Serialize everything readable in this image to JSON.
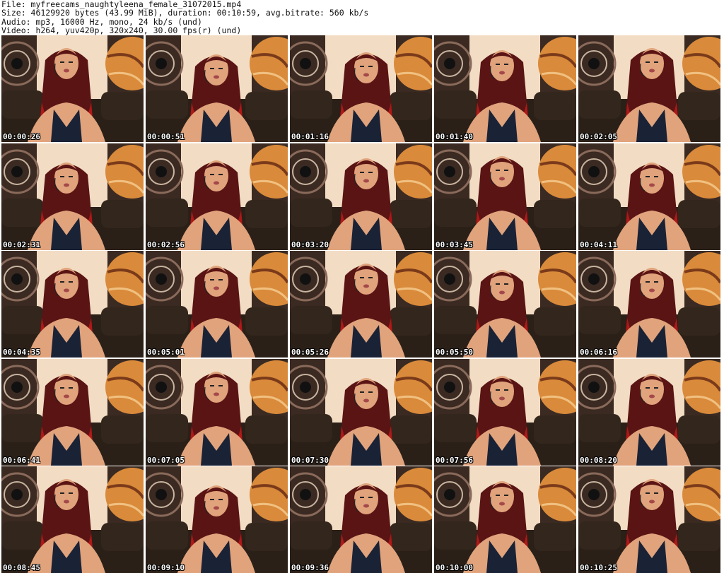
{
  "info": {
    "file": "File: myfreecams_naughtyleena_female_31072015.mp4",
    "size": "Size: 46129920 bytes (43.99 MiB), duration: 00:10:59, avg.bitrate: 560 kb/s",
    "audio": "Audio: mp3, 16000 Hz, mono, 24 kb/s (und)",
    "video": "Video: h264, yuv420p, 320x240, 30.00 fps(r) (und)"
  },
  "thumbnails": [
    {
      "time": "00:00:26"
    },
    {
      "time": "00:00:51"
    },
    {
      "time": "00:01:16"
    },
    {
      "time": "00:01:40"
    },
    {
      "time": "00:02:05"
    },
    {
      "time": "00:02:31"
    },
    {
      "time": "00:02:56"
    },
    {
      "time": "00:03:20"
    },
    {
      "time": "00:03:45"
    },
    {
      "time": "00:04:11"
    },
    {
      "time": "00:04:35"
    },
    {
      "time": "00:05:01"
    },
    {
      "time": "00:05:26"
    },
    {
      "time": "00:05:50"
    },
    {
      "time": "00:06:16"
    },
    {
      "time": "00:06:41"
    },
    {
      "time": "00:07:05"
    },
    {
      "time": "00:07:30"
    },
    {
      "time": "00:07:56"
    },
    {
      "time": "00:08:20"
    },
    {
      "time": "00:08:45"
    },
    {
      "time": "00:09:10"
    },
    {
      "time": "00:09:36"
    },
    {
      "time": "00:10:00"
    },
    {
      "time": "00:10:25"
    }
  ],
  "colors": {
    "wall": "#f2dcc4",
    "couch": "#2b2018",
    "poster_dark": "#3a2a22",
    "poster_orange": "#d98a3a",
    "hair": "#5a1414",
    "hair_tips": "#b01818",
    "skin": "#e0a37c",
    "top": "#1a2236"
  }
}
